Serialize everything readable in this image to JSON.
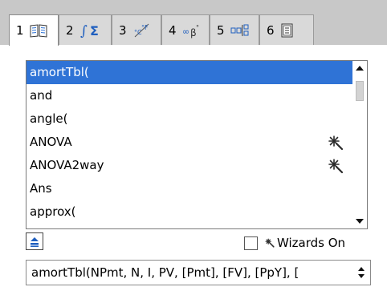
{
  "tabs": [
    {
      "number": "1",
      "icon": "catalog-book-icon",
      "active": true
    },
    {
      "number": "2",
      "icon": "integral-sigma-icon",
      "active": false
    },
    {
      "number": "3",
      "icon": "units-conversion-icon",
      "active": false
    },
    {
      "number": "4",
      "icon": "symbols-icon",
      "active": false
    },
    {
      "number": "5",
      "icon": "math-templates-icon",
      "active": false
    },
    {
      "number": "6",
      "icon": "library-icon",
      "active": false
    }
  ],
  "catalog_list": {
    "items": [
      {
        "label": "amortTbl(",
        "selected": true,
        "wizard": false
      },
      {
        "label": "and",
        "selected": false,
        "wizard": false
      },
      {
        "label": "angle(",
        "selected": false,
        "wizard": false
      },
      {
        "label": "ANOVA",
        "selected": false,
        "wizard": true
      },
      {
        "label": "ANOVA2way",
        "selected": false,
        "wizard": true
      },
      {
        "label": "Ans",
        "selected": false,
        "wizard": false
      },
      {
        "label": "approx(",
        "selected": false,
        "wizard": false
      }
    ]
  },
  "wizards_toggle": {
    "label": "Wizards On",
    "checked": false
  },
  "syntax_help": {
    "text": "amortTbl(NPmt, N, I, PV, [Pmt], [FV], [PpY], ["
  },
  "colors": {
    "selection": "#2f73d6",
    "tab_bar": "#c8c8c8",
    "button_accent": "#1f5fbf"
  }
}
